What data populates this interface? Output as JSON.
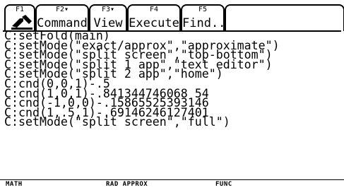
{
  "toolbar": {
    "tabs": [
      {
        "fkey": "F1",
        "label": ""
      },
      {
        "fkey": "F2▾",
        "label": "Command"
      },
      {
        "fkey": "F3▾",
        "label": "View"
      },
      {
        "fkey": "F4",
        "label": "Execute"
      },
      {
        "fkey": "F5",
        "label": "Find..."
      }
    ],
    "f1_icon": "tools-icon"
  },
  "history": {
    "lines": [
      "C:setFold(main)",
      "C:setMode(\"exact/approx\",\"approximate\")",
      "C:setMode(\"split screen\",\"top-bottom\")",
      "C:setMode(\"split 1 app\",\"text editor\")",
      "C:setMode(\"split 2 app\",\"home\")",
      "C:cnd(0,0,1)-.5",
      "C:cnd(1,0,1)-.841344746068 54",
      "C:cnd(-1,0,0)-.15865525393146",
      "C:cnd(1,.5,1)-.69146246127401",
      "C:setMode(\"split screen\",\"full\")"
    ]
  },
  "status_bar": {
    "mode": "MATH",
    "angle_exact": "RAD APPROX",
    "graph": "FUNC"
  }
}
